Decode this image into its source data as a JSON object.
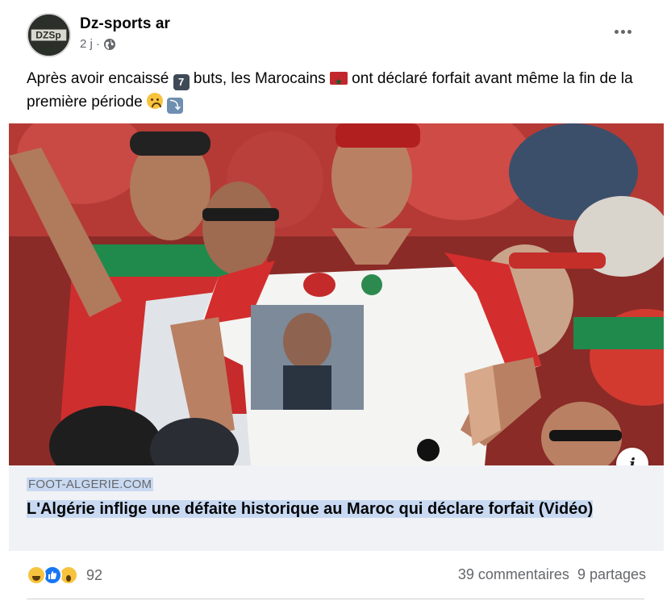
{
  "post": {
    "page_name": "Dz-sports ar",
    "avatar_text": "DZSp",
    "timestamp": "2 j",
    "separator": "·",
    "text_part1": "Après avoir encaissé ",
    "emoji_seven": "7",
    "text_part2": " buts, les Marocains ",
    "text_part3": " ont déclaré forfait avant même la fin de la première période ",
    "icons": {
      "more": "more-options-icon",
      "audience": "globe-icon",
      "info": "info-icon"
    }
  },
  "link": {
    "domain": "FOOT-ALGERIE.COM",
    "title": "L'Algérie inflige une défaite historique au Maroc qui déclare forfait (Vidéo)",
    "info_label": "i"
  },
  "engagement": {
    "reactions": [
      "haha",
      "like",
      "wow"
    ],
    "reaction_count": "92",
    "comments": "39 commentaires",
    "shares": "9 partages"
  },
  "colors": {
    "text_primary": "#050505",
    "text_secondary": "#65676b",
    "highlight": "#c9d9f2",
    "card_footer": "#f0f2f5",
    "like_blue": "#1877f2",
    "morocco_red": "#c1272d",
    "morocco_green": "#006233"
  }
}
